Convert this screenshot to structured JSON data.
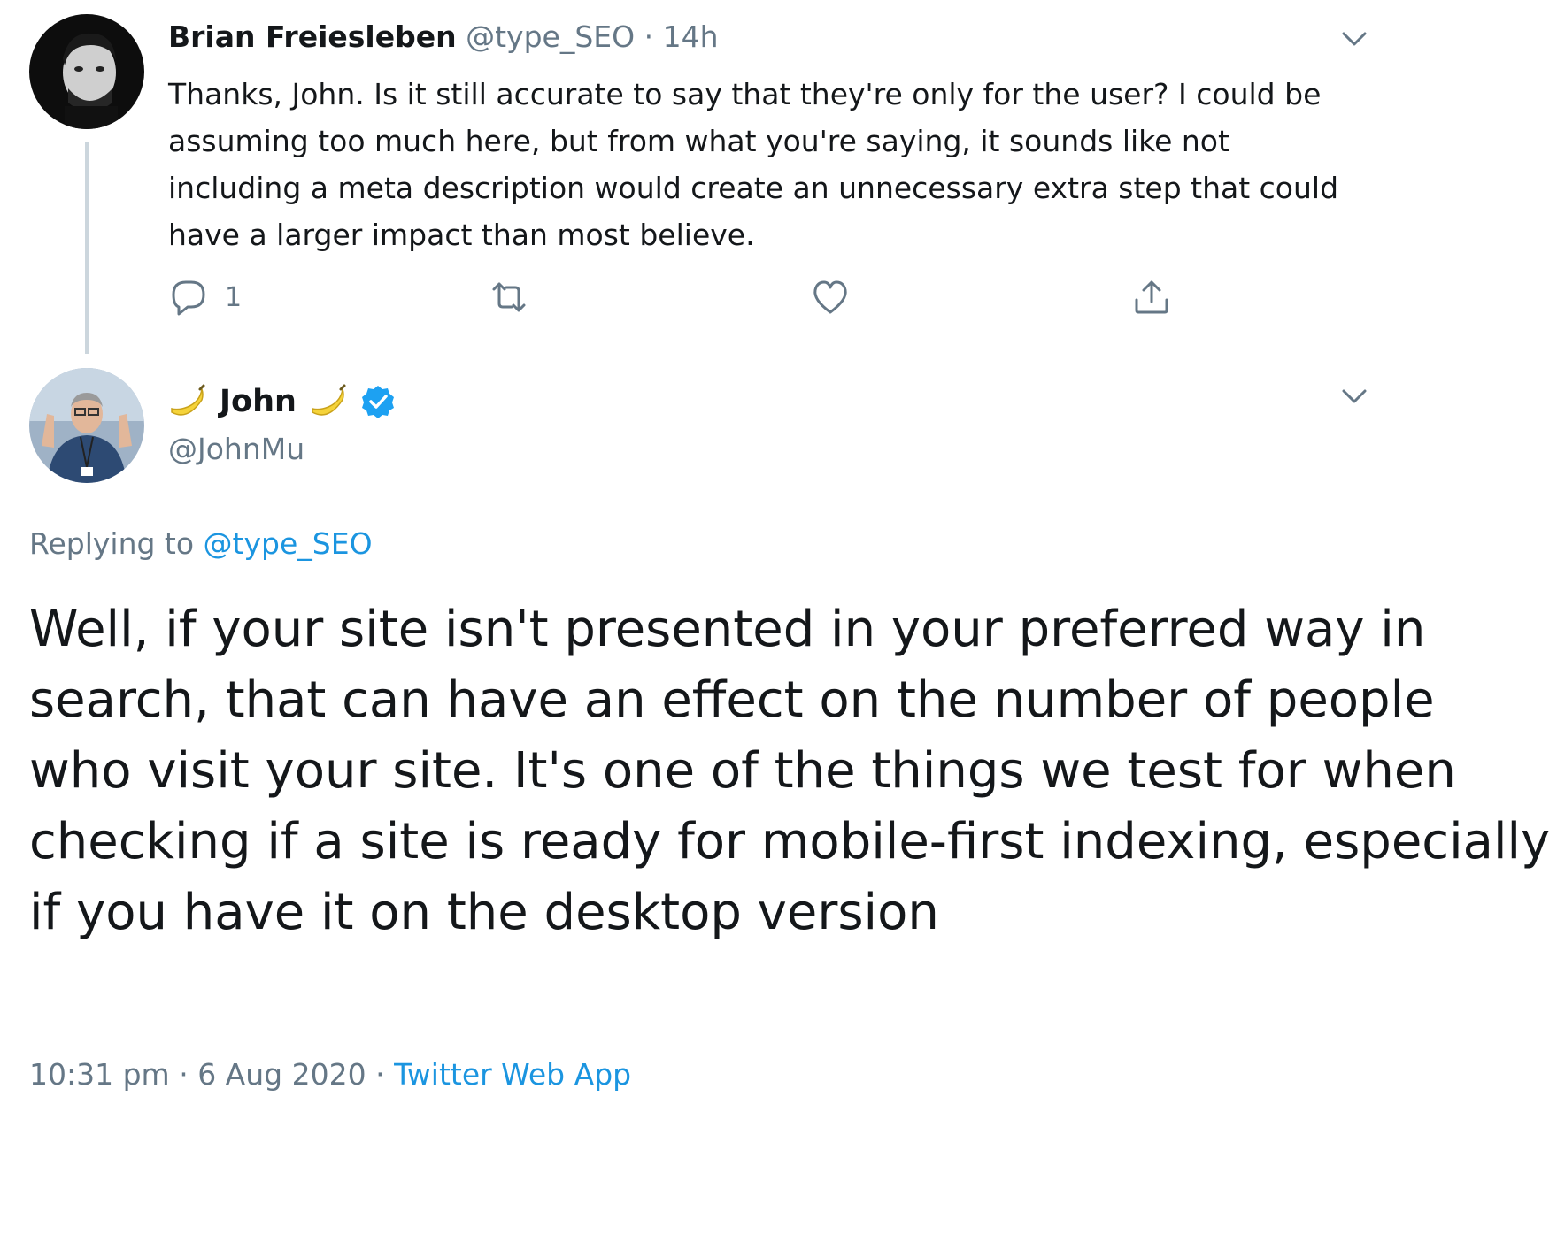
{
  "reply_tweet": {
    "author_name": "Brian Freiesleben",
    "handle": "@type_SEO",
    "separator": "·",
    "time": "14h",
    "text": "Thanks, John. Is it still accurate to say that they're only for the user? I could be assuming too much here, but from what you're saying, it sounds like not including a meta description would create an unnecessary extra step that could have a larger impact than most believe.",
    "reply_count": "1",
    "icons": [
      "reply-icon",
      "retweet-icon",
      "like-icon",
      "share-icon",
      "chevron-down-icon"
    ]
  },
  "main_tweet": {
    "author_name": "John",
    "handle": "@JohnMu",
    "verified": true,
    "name_emoji": "banana",
    "replying_label": "Replying to",
    "replying_to": "@type_SEO",
    "text": "Well, if your site isn't presented in your preferred way in search, that can have an effect on the number of people who visit your site. It's one of the things we test for when checking if a site is ready for mobile-first indexing, especially if you have it on the desktop version",
    "time": "10:31 pm",
    "date": "6 Aug 2020",
    "separator": "·",
    "source": "Twitter Web App"
  },
  "colors": {
    "text": "#14171a",
    "secondary": "#657786",
    "link": "#1b95e0",
    "thread_line": "#ccd6dd"
  }
}
